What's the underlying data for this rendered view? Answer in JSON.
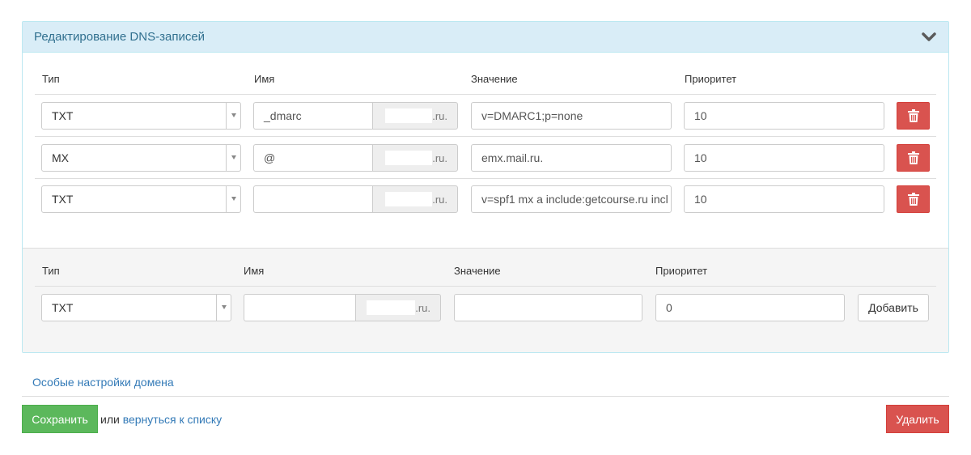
{
  "panel": {
    "title": "Редактирование DNS-записей",
    "collapse_icon": "chevron-down-icon"
  },
  "records_header": {
    "type": "Тип",
    "name": "Имя",
    "value": "Значение",
    "priority": "Приоритет"
  },
  "records": [
    {
      "type": "TXT",
      "name": "_dmarc",
      "domain_suffix": ".ru.",
      "value": "v=DMARC1;p=none",
      "priority": "10"
    },
    {
      "type": "MX",
      "name": "@",
      "domain_suffix": ".ru.",
      "value": "emx.mail.ru.",
      "priority": "10"
    },
    {
      "type": "TXT",
      "name": "",
      "domain_suffix": ".ru.",
      "value": "v=spf1 mx a include:getcourse.ru incl",
      "priority": "10"
    }
  ],
  "delete_icon": "trash-icon",
  "new_record": {
    "header": {
      "type": "Тип",
      "name": "Имя",
      "value": "Значение",
      "priority": "Приоритет"
    },
    "type": "TXT",
    "name": "",
    "domain_suffix": ".ru.",
    "value": "",
    "priority": "0",
    "add_label": "Добавить"
  },
  "footer": {
    "special_settings_link": "Особые настройки домена",
    "save_label": "Сохранить",
    "or_text": "или",
    "back_link": "вернуться к списку",
    "delete_label": "Удалить"
  },
  "colors": {
    "heading_bg": "#d9edf7",
    "heading_text": "#31708f",
    "danger": "#d9534f",
    "success": "#5cb85c",
    "link": "#337ab7"
  }
}
